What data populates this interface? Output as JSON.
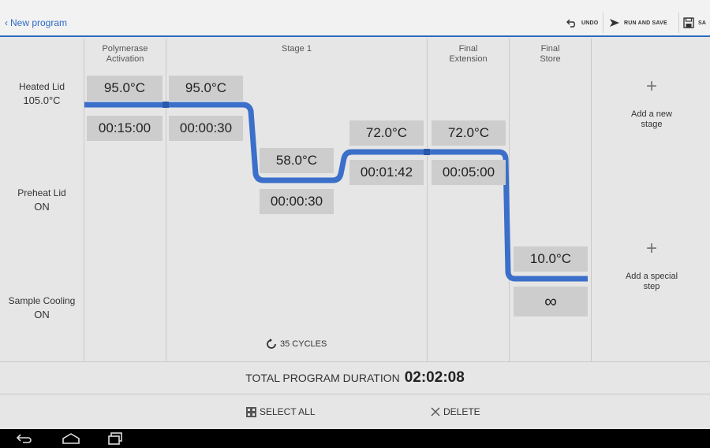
{
  "header": {
    "back_label": "New program",
    "undo_label": "UNDO",
    "run_save_label": "RUN AND SAVE",
    "save_label": "SA"
  },
  "stages": [
    {
      "title": "Polymerase\nActivation"
    },
    {
      "title": "Stage 1"
    },
    {
      "title": "Final\nExtension"
    },
    {
      "title": "Final\nStore"
    }
  ],
  "settings": {
    "heated_lid_label": "Heated Lid",
    "heated_lid_value": "105.0°C",
    "preheat_lid_label": "Preheat Lid",
    "preheat_lid_value": "ON",
    "sample_cooling_label": "Sample Cooling",
    "sample_cooling_value": "ON"
  },
  "steps": [
    {
      "temp": "95.0°C",
      "time": "00:15:00"
    },
    {
      "temp": "95.0°C",
      "time": "00:00:30"
    },
    {
      "temp": "58.0°C",
      "time": "00:00:30"
    },
    {
      "temp": "72.0°C",
      "time": "00:01:42"
    },
    {
      "temp": "72.0°C",
      "time": "00:05:00"
    },
    {
      "temp": "10.0°C",
      "time": "∞"
    }
  ],
  "cycles_label": "35 CYCLES",
  "add_stage_label": "Add a new\nstage",
  "add_special_label": "Add a special\nstep",
  "total": {
    "label": "TOTAL PROGRAM DURATION",
    "value": "02:02:08"
  },
  "actions": {
    "select_all": "SELECT ALL",
    "delete": "DELETE"
  },
  "colors": {
    "accent": "#2d6bc2",
    "profile_line": "#3b6fc9"
  }
}
